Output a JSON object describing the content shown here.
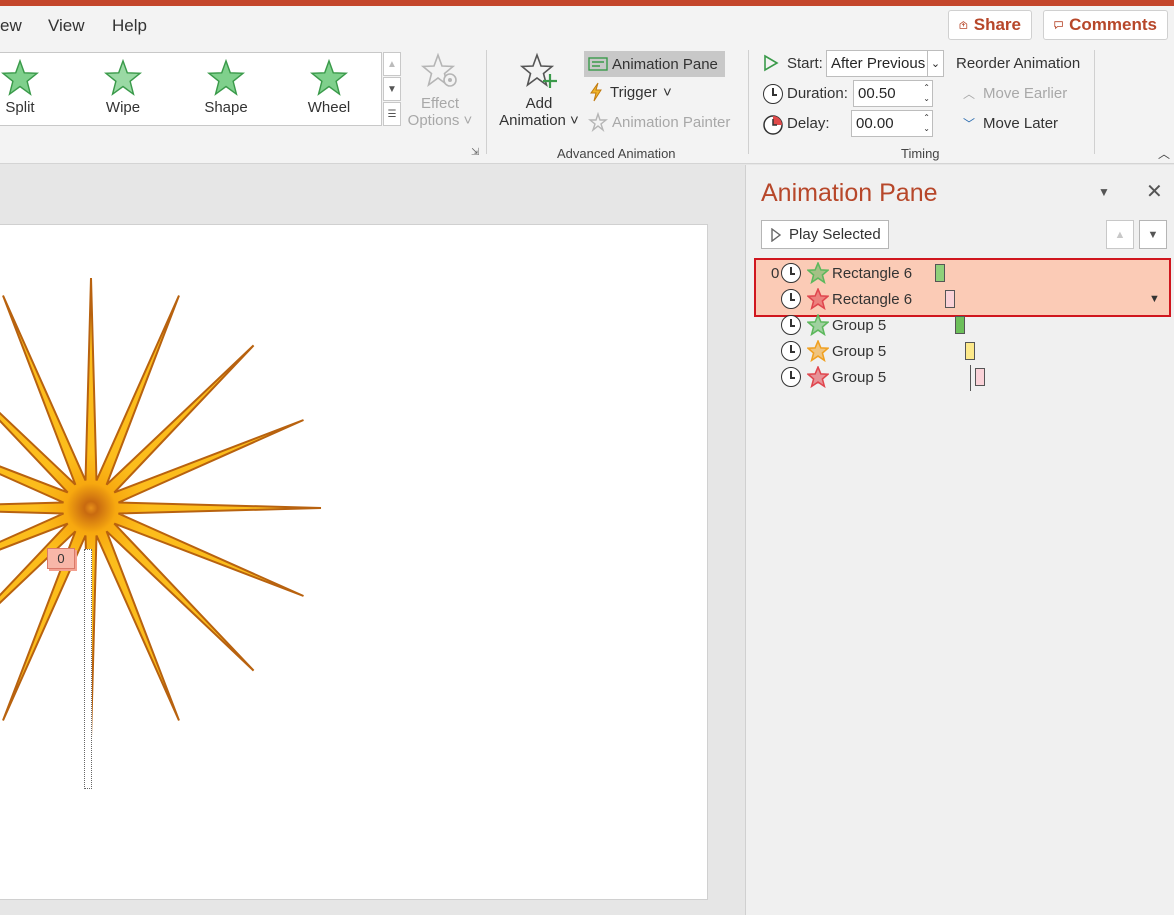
{
  "menu": {
    "items": [
      "ew",
      "View",
      "Help"
    ],
    "share_label": "Share",
    "comments_label": "Comments"
  },
  "gallery": {
    "items": [
      {
        "label": "Split"
      },
      {
        "label": "Wipe"
      },
      {
        "label": "Shape"
      },
      {
        "label": "Wheel"
      }
    ]
  },
  "ribbon": {
    "effect_options": [
      "Effect",
      "Options"
    ],
    "add_animation": [
      "Add",
      "Animation"
    ],
    "animation_pane_label": "Animation Pane",
    "trigger_label": "Trigger",
    "animation_painter_label": "Animation Painter",
    "advanced_group_label": "Advanced Animation",
    "start_label": "Start:",
    "start_value": "After Previous",
    "duration_label": "Duration:",
    "duration_value": "00.50",
    "delay_label": "Delay:",
    "delay_value": "00.00",
    "timing_group_label": "Timing",
    "reorder_label": "Reorder Animation",
    "move_earlier_label": "Move Earlier",
    "move_later_label": "Move Later"
  },
  "slide": {
    "tag_label": "0"
  },
  "pane": {
    "title": "Animation Pane",
    "play_selected_label": "Play Selected",
    "rows": [
      {
        "index": "0",
        "name": "Rectangle 6",
        "star_color": "#5cb85c",
        "bar_color": "#8fd07a"
      },
      {
        "index": "",
        "name": "Rectangle 6",
        "star_color": "#e0464e",
        "bar_color": "#fad2d8"
      },
      {
        "index": "",
        "name": "Group 5",
        "star_color": "#5cb85c",
        "bar_color": "#6cbf5a"
      },
      {
        "index": "",
        "name": "Group 5",
        "star_color": "#f0a020",
        "bar_color": "#fde98a"
      },
      {
        "index": "",
        "name": "Group 5",
        "star_color": "#e0464e",
        "bar_color": "#fad2d8"
      }
    ]
  },
  "colors": {
    "accent": "#b7472a",
    "selection_border": "#d0161e",
    "selection_fill": "#fbcbb6"
  }
}
